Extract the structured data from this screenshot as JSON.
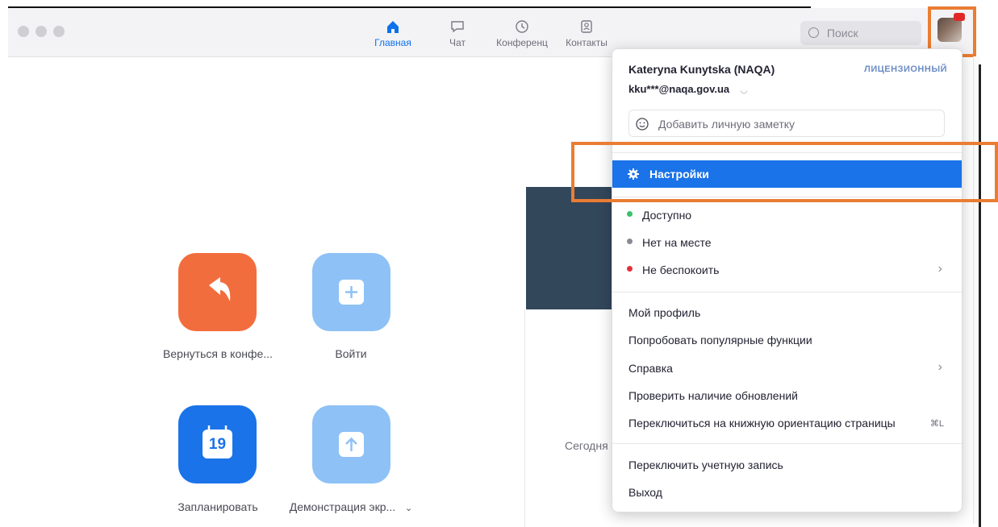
{
  "nav": {
    "tabs": [
      {
        "label": "Главная",
        "icon": "home-icon",
        "active": true
      },
      {
        "label": "Чат",
        "icon": "chat-icon",
        "active": false
      },
      {
        "label": "Конференц",
        "icon": "clock-icon",
        "active": false
      },
      {
        "label": "Контакты",
        "icon": "contacts-icon",
        "active": false
      }
    ],
    "search_placeholder": "Поиск"
  },
  "home": {
    "actions": [
      {
        "label": "Вернуться в конфе...",
        "icon": "return-arrow-icon",
        "color": "#f26d3d"
      },
      {
        "label": "Войти",
        "icon": "plus-icon",
        "color": "#8ec1f6"
      },
      {
        "label": "Запланировать",
        "icon": "calendar-icon",
        "color": "#1a73e8",
        "calendar_day": "19"
      },
      {
        "label": "Демонстрация экр...",
        "icon": "share-up-icon",
        "color": "#8ec1f6"
      }
    ],
    "today_text": "Сегодня"
  },
  "profile_menu": {
    "user_name": "Kateryna Kunytska (NAQA)",
    "license_badge": "ЛИЦЕНЗИОННЫЙ",
    "email": "kku***@naqa.gov.ua",
    "note_placeholder": "Добавить личную заметку",
    "settings_label": "Настройки",
    "statuses": [
      {
        "label": "Доступно",
        "color": "#3cc16b"
      },
      {
        "label": "Нет на месте",
        "color": "#8a8a96"
      },
      {
        "label": "Не беспокоить",
        "color": "#e0323a"
      }
    ],
    "items_group1": [
      "Мой профиль",
      "Попробовать популярные функции",
      "Справка",
      "Проверить наличие обновлений",
      "Переключиться на книжную ориентацию страницы"
    ],
    "portrait_shortcut": "⌘L",
    "items_group2": [
      "Переключить учетную запись",
      "Выход"
    ]
  },
  "colors": {
    "accent": "#0e71eb",
    "highlight": "#1a73e8",
    "annotation": "#ea7d33"
  }
}
